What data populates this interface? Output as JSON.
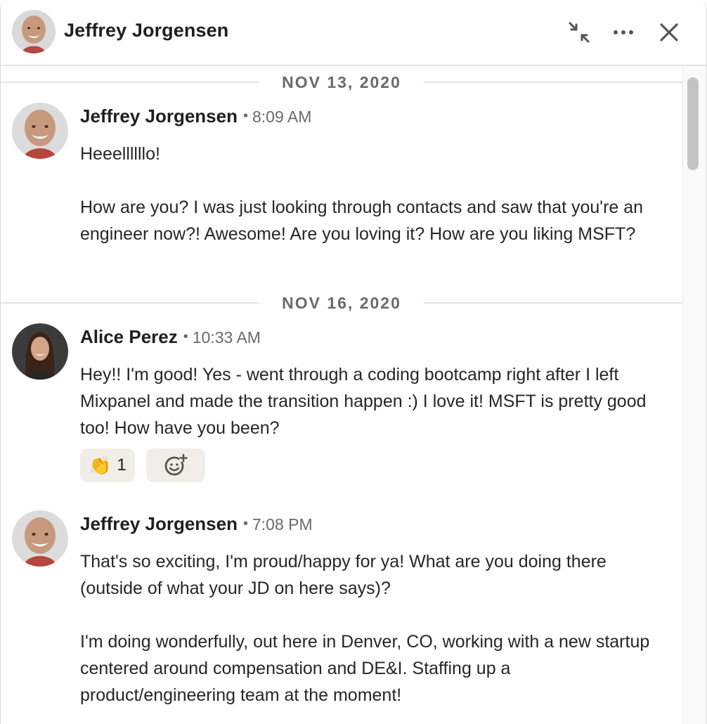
{
  "header": {
    "title": "Jeffrey Jorgensen",
    "icons": [
      "minimize-icon",
      "more-icon",
      "close-icon"
    ]
  },
  "conversation": {
    "separators": [
      {
        "label": "NOV 13, 2020"
      },
      {
        "label": "NOV 16, 2020"
      }
    ],
    "messages": [
      {
        "sender": "Jeffrey Jorgensen",
        "time": "8:09 AM",
        "paragraphs": [
          "Heeellllllo!",
          "How are you? I was just looking through contacts and saw that you're an engineer now?! Awesome! Are you loving it? How are you liking MSFT?"
        ]
      },
      {
        "sender": "Alice Perez",
        "time": "10:33 AM",
        "paragraphs": [
          "Hey!! I'm good! Yes - went through a coding bootcamp right after I left Mixpanel and made the transition happen :) I love it! MSFT is pretty good too! How have you been?"
        ],
        "reactions": [
          {
            "emoji": "👏",
            "icon": "clapping-hands-icon",
            "count": "1"
          }
        ]
      },
      {
        "sender": "Jeffrey Jorgensen",
        "time": "7:08 PM",
        "paragraphs": [
          "That's so exciting, I'm proud/happy for ya! What are you doing there (outside of what your JD on here says)?",
          "I'm doing wonderfully, out here in Denver, CO, working with a new startup centered around compensation and DE&I. Staffing up a product/engineering team at the moment!"
        ]
      }
    ]
  },
  "colors": {
    "separator_line": "#e3e3e3",
    "muted_text": "#6a6a6a",
    "reaction_bg": "#f1eee8"
  }
}
